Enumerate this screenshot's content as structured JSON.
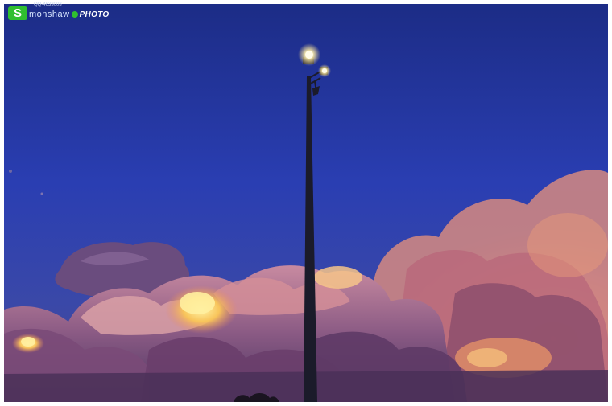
{
  "watermark": {
    "letter": "S",
    "name": "monshaw",
    "qq": "QQ-4633003",
    "photo": "PHOTO"
  },
  "colors": {
    "sky_top": "#1f2f8a",
    "sky_mid": "#2a3fb0",
    "cloud_warm": "#f0a070",
    "cloud_glow": "#ffe27a",
    "cloud_shadow": "#5a3a6a",
    "pole": "#1b1b2a",
    "lamp": "#fff6c8"
  },
  "icons": [
    "streetlight-pole",
    "lamp-glow",
    "cloud-bank"
  ]
}
